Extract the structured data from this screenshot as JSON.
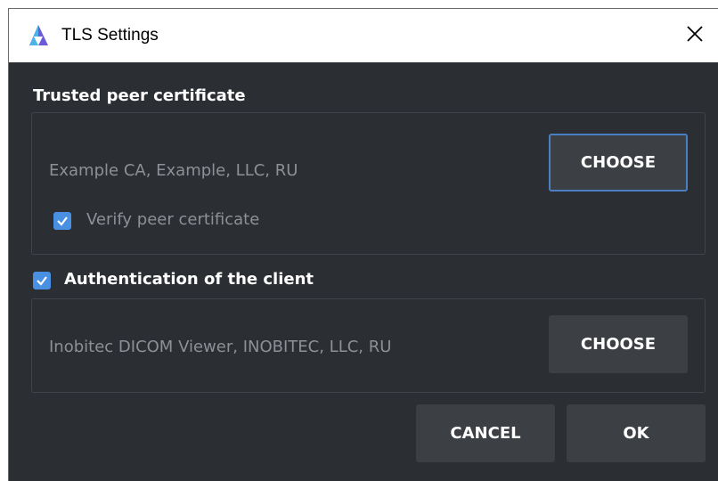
{
  "window": {
    "title": "TLS Settings",
    "close_icon": "close-icon",
    "app_icon": "app-logo-icon"
  },
  "trusted_peer": {
    "section_label": "Trusted peer certificate",
    "certificate_name": "Example CA, Example, LLC, RU",
    "choose_label": "CHOOSE",
    "verify_label": "Verify peer certificate",
    "verify_checked": true
  },
  "client_auth": {
    "section_label": "Authentication of the client",
    "checked": true,
    "certificate_name": "Inobitec DICOM Viewer, INOBITEC, LLC, RU",
    "choose_label": "CHOOSE"
  },
  "footer": {
    "cancel_label": "CANCEL",
    "ok_label": "OK"
  },
  "colors": {
    "background": "#2b2e33",
    "button": "#3c3f44",
    "accent": "#4a90e2",
    "muted_text": "#8d9196"
  }
}
